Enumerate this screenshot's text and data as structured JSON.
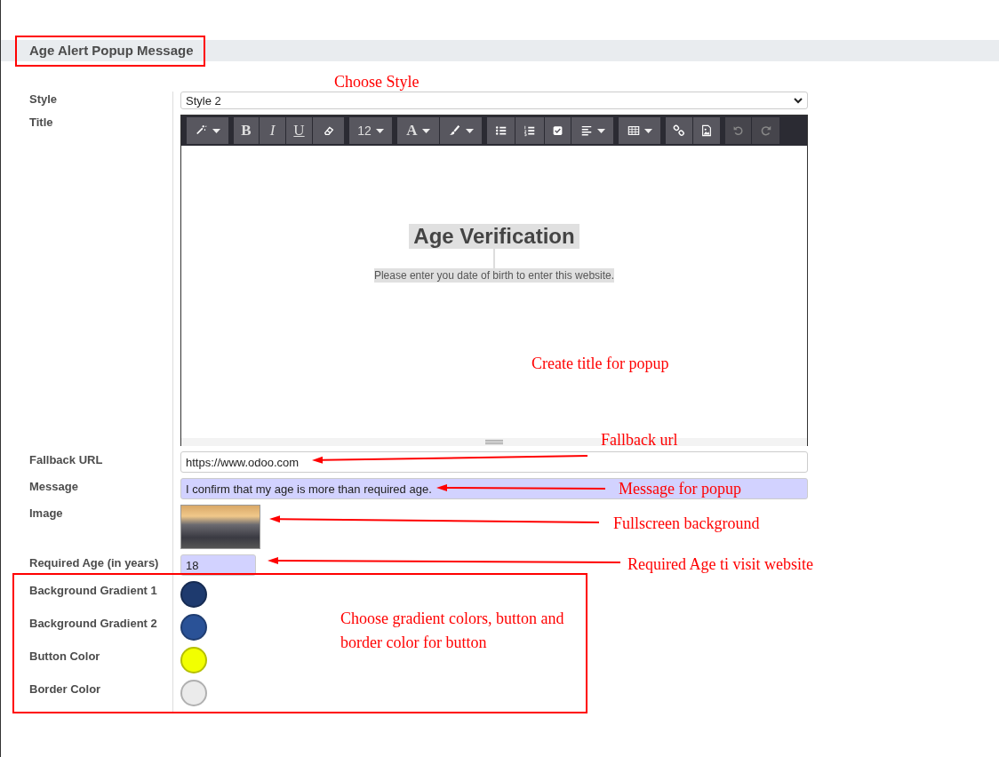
{
  "section_title": "Age Alert Popup Message",
  "fields": [
    {
      "kind": "select",
      "label": "Style",
      "value": "Style 2"
    },
    {
      "kind": "editor",
      "label": "Title",
      "heading": "Age Verification",
      "text": "Please enter you date of birth to enter this website."
    },
    {
      "kind": "text",
      "label": "Fallback URL",
      "value": "https://www.odoo.com",
      "highlighted": false
    },
    {
      "kind": "text",
      "label": "Message",
      "value": "I confirm that my age is more than required age.",
      "highlighted": true
    },
    {
      "kind": "image",
      "label": "Image"
    },
    {
      "kind": "number",
      "label": "Required Age (in years)",
      "value": "18",
      "highlighted": true
    },
    {
      "kind": "color",
      "label": "Background Gradient 1",
      "color": "#1e3a6e"
    },
    {
      "kind": "color",
      "label": "Background Gradient 2",
      "color": "#2a5297"
    },
    {
      "kind": "color",
      "label": "Button Color",
      "color": "#f2ff00"
    },
    {
      "kind": "color",
      "label": "Border Color",
      "color": "#ebebeb"
    }
  ],
  "toolbar": [
    [
      {
        "kind": "magic",
        "dropdown": true
      }
    ],
    [
      {
        "kind": "bold",
        "label": "B"
      },
      {
        "kind": "italic",
        "label": "I"
      },
      {
        "kind": "underline",
        "label": "U"
      },
      {
        "kind": "eraser"
      }
    ],
    [
      {
        "kind": "size",
        "label": "12",
        "dropdown": true
      }
    ],
    [
      {
        "kind": "font-color",
        "label": "A",
        "dropdown": true
      },
      {
        "kind": "brush",
        "dropdown": true
      }
    ],
    [
      {
        "kind": "bullets"
      },
      {
        "kind": "numbers"
      },
      {
        "kind": "checkbox"
      },
      {
        "kind": "align",
        "dropdown": true
      }
    ],
    [
      {
        "kind": "table",
        "dropdown": true
      }
    ],
    [
      {
        "kind": "link"
      },
      {
        "kind": "picture"
      }
    ],
    [
      {
        "kind": "undo",
        "disabled": true
      },
      {
        "kind": "redo",
        "disabled": true
      }
    ]
  ],
  "annotations": [
    {
      "text": "Choose Style",
      "arrow": false
    },
    {
      "text": "Create title for popup",
      "arrow": false
    },
    {
      "text": "Fallback url",
      "arrow": true
    },
    {
      "text": "Message for popup",
      "arrow": true
    },
    {
      "text": "Fullscreen background",
      "arrow": true
    },
    {
      "text": "Required Age ti visit website",
      "arrow": true
    },
    {
      "text": "Choose gradient colors, button and border color for button",
      "arrow": false
    }
  ]
}
